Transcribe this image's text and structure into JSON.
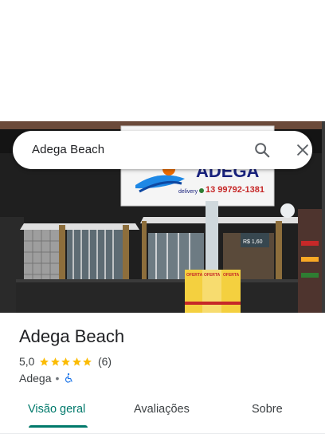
{
  "search": {
    "query": "Adega Beach"
  },
  "photo": {
    "sign_brand": "ADEGA",
    "sign_delivery": "delivery",
    "sign_phone": "13 99792-1381",
    "poster_1": "OFERTA",
    "poster_2": "OFERTA",
    "poster_3": "OFERTA",
    "small_sign": "R$ 1,60"
  },
  "place": {
    "name": "Adega Beach",
    "rating": "5,0",
    "rating_stars": 5,
    "reviews": "(6)",
    "category": "Adega",
    "separator": "•"
  },
  "tabs": [
    {
      "label": "Visão geral",
      "active": true
    },
    {
      "label": "Avaliações",
      "active": false
    },
    {
      "label": "Sobre",
      "active": false
    }
  ],
  "colors": {
    "accent": "#00796b",
    "star": "#fbbc04",
    "wheelchair": "#1a73e8"
  }
}
